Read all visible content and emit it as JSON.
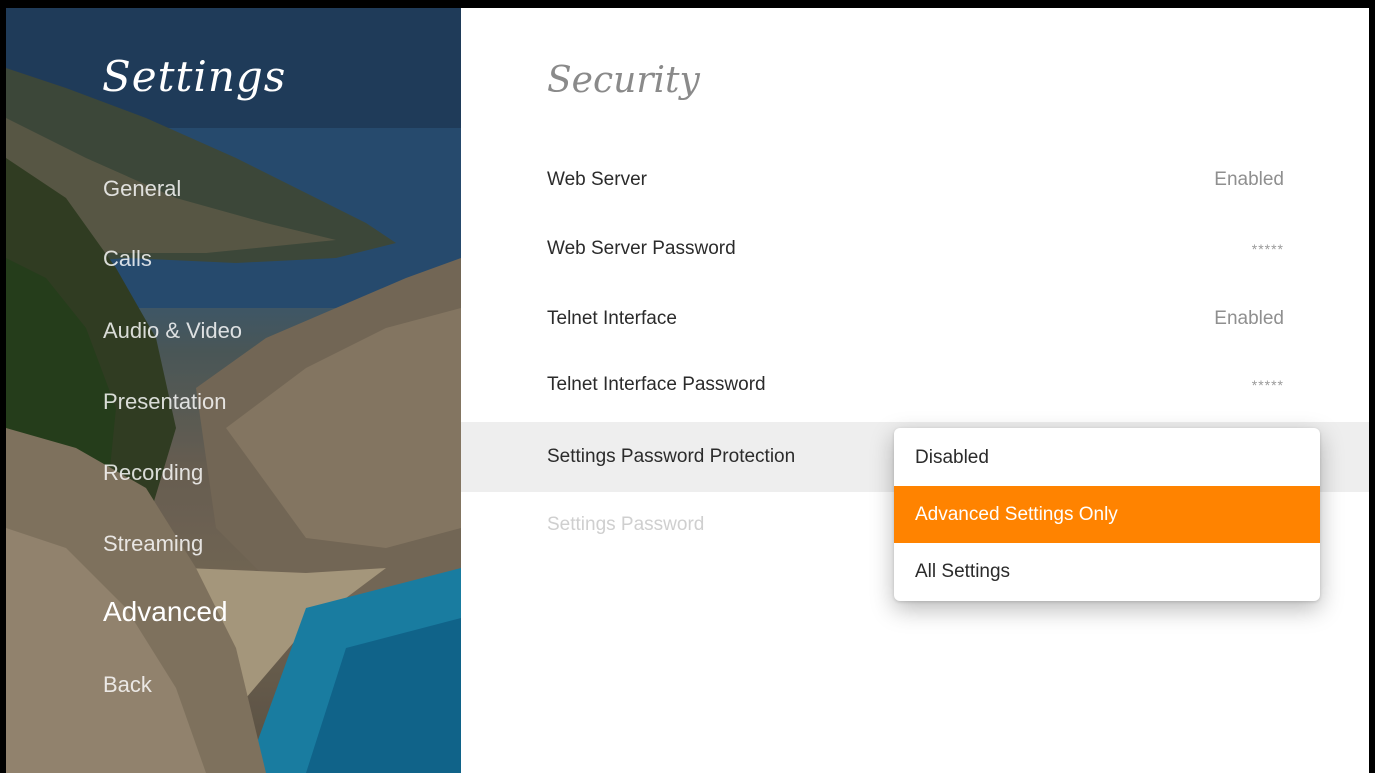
{
  "sidebar": {
    "title": "Settings",
    "items": [
      {
        "label": "General"
      },
      {
        "label": "Calls"
      },
      {
        "label": "Audio & Video"
      },
      {
        "label": "Presentation"
      },
      {
        "label": "Recording"
      },
      {
        "label": "Streaming"
      },
      {
        "label": "Advanced",
        "active": true
      },
      {
        "label": "Back"
      }
    ]
  },
  "main": {
    "section_title": "Security",
    "rows": [
      {
        "label": "Web Server",
        "value": "Enabled"
      },
      {
        "label": "Web Server Password",
        "value": "*****"
      },
      {
        "label": "Telnet Interface",
        "value": "Enabled"
      },
      {
        "label": "Telnet Interface Password",
        "value": "*****"
      },
      {
        "label": "Settings Password Protection",
        "value": ""
      },
      {
        "label": "Settings Password",
        "value": "",
        "disabled": true
      }
    ]
  },
  "dropdown": {
    "options": [
      {
        "label": "Disabled"
      },
      {
        "label": "Advanced Settings Only",
        "selected": true
      },
      {
        "label": "All Settings"
      }
    ]
  },
  "colors": {
    "accent": "#ff8300",
    "highlight_row": "#eeeeee"
  }
}
